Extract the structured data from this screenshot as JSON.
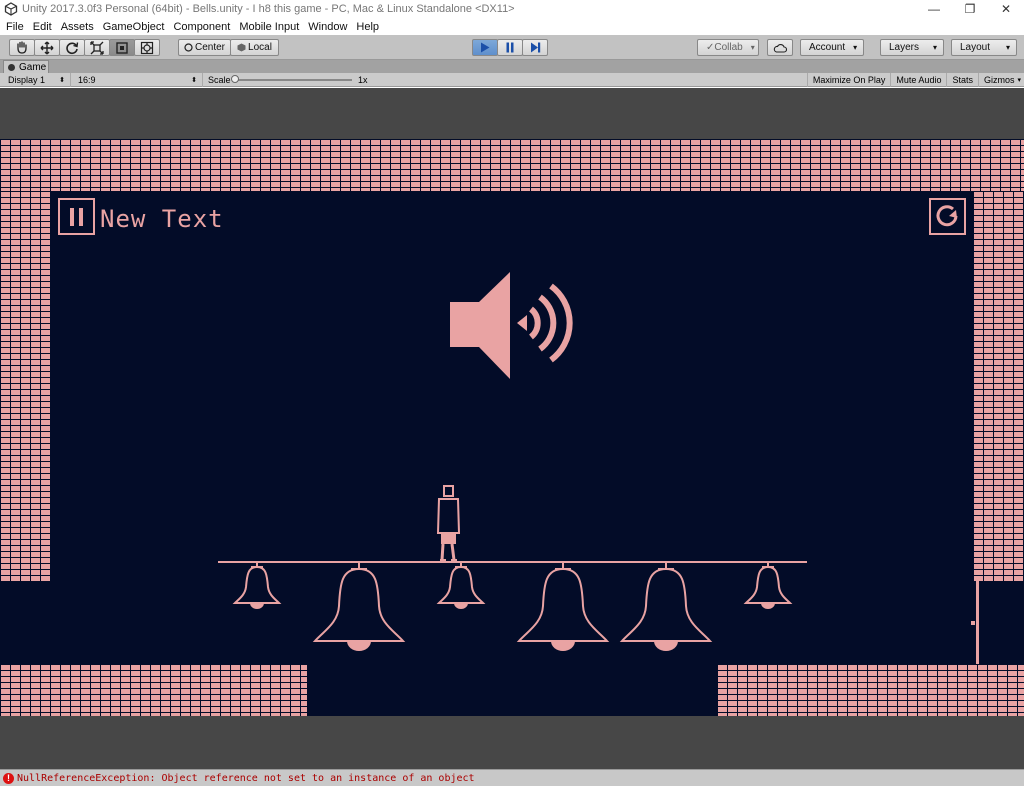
{
  "window": {
    "title": "Unity 2017.3.0f3 Personal (64bit) - Bells.unity - I h8 this game - PC, Mac & Linux Standalone <DX11>",
    "controls": [
      "—",
      "❐",
      "✕"
    ]
  },
  "menu": [
    "File",
    "Edit",
    "Assets",
    "GameObject",
    "Component",
    "Mobile Input",
    "Window",
    "Help"
  ],
  "toolbar": {
    "pivot_label": "Center",
    "space_label": "Local",
    "collab_label": "Collab",
    "account_label": "Account",
    "layers_label": "Layers",
    "layout_label": "Layout",
    "play_state": "playing",
    "accent_play": "#5f8fcc"
  },
  "game_tab": {
    "label": "Game",
    "display": "Display 1",
    "aspect": "16:9",
    "scale_label": "Scale",
    "scale_value": "1x",
    "maximize_on_play": "Maximize On Play",
    "mute_audio": "Mute Audio",
    "stats": "Stats",
    "gizmos": "Gizmos"
  },
  "game": {
    "ui_text": "New Text",
    "pause_icon": "pause-icon",
    "restart_icon": "restart-icon",
    "speaker_icon": "speaker-icon",
    "palette": {
      "background": "#030c28",
      "foreground": "#e9a3a3"
    }
  },
  "status": {
    "error": "NullReferenceException: Object reference not set to an instance of an object"
  }
}
